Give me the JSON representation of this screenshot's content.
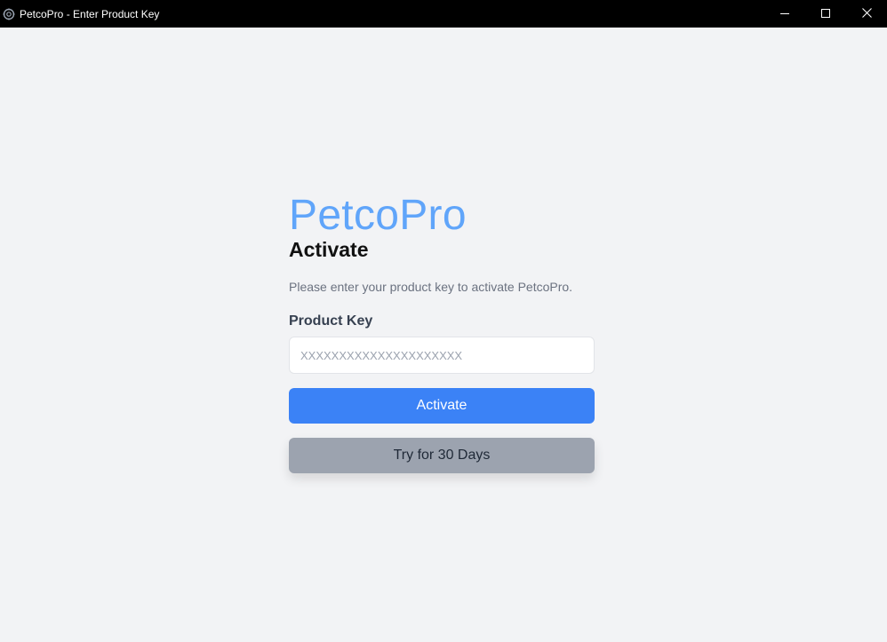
{
  "window": {
    "title": "PetcoPro - Enter Product Key",
    "icon": "app-gear-icon",
    "controls": [
      "minimize-icon",
      "maximize-icon",
      "close-icon"
    ]
  },
  "main": {
    "brand": "PetcoPro",
    "heading": "Activate",
    "subtitle": "Please enter your product key to activate PetcoPro.",
    "product_key_label": "Product Key",
    "product_key_value": "",
    "product_key_placeholder": "XXXXXXXXXXXXXXXXXXXXX",
    "activate_label": "Activate",
    "trial_label": "Try for 30 Days"
  },
  "colors": {
    "brand": "#60a5fa",
    "primary_button": "#3b82f6",
    "secondary_button": "#9ca3af",
    "background": "#f2f3f5",
    "titlebar": "#000000"
  }
}
